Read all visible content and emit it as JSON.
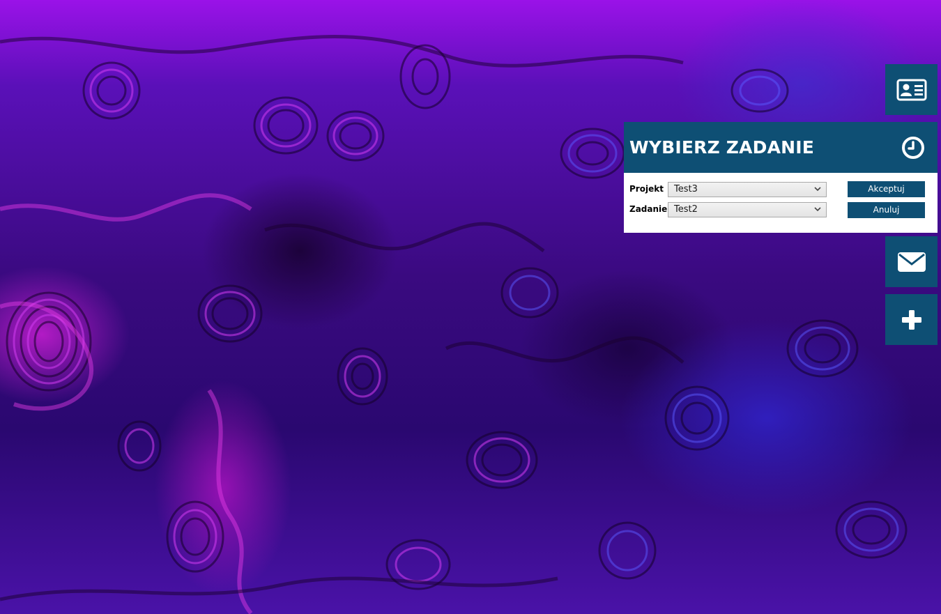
{
  "dialog": {
    "title": "WYBIERZ ZADANIE",
    "project_label": "Projekt",
    "project_value": "Test3",
    "task_label": "Zadanie",
    "task_value": "Test2",
    "accept_label": "Akceptuj",
    "cancel_label": "Anuluj"
  },
  "side_buttons": [
    {
      "icon": "contact-card-icon"
    },
    {
      "icon": "clock-icon"
    },
    {
      "icon": "envelope-icon"
    },
    {
      "icon": "plus-icon"
    }
  ],
  "colors": {
    "accent": "#0e4f74",
    "panel_bg": "#ffffff",
    "wallpaper_primary": "#9a12e8",
    "wallpaper_secondary": "#3a0a80"
  }
}
